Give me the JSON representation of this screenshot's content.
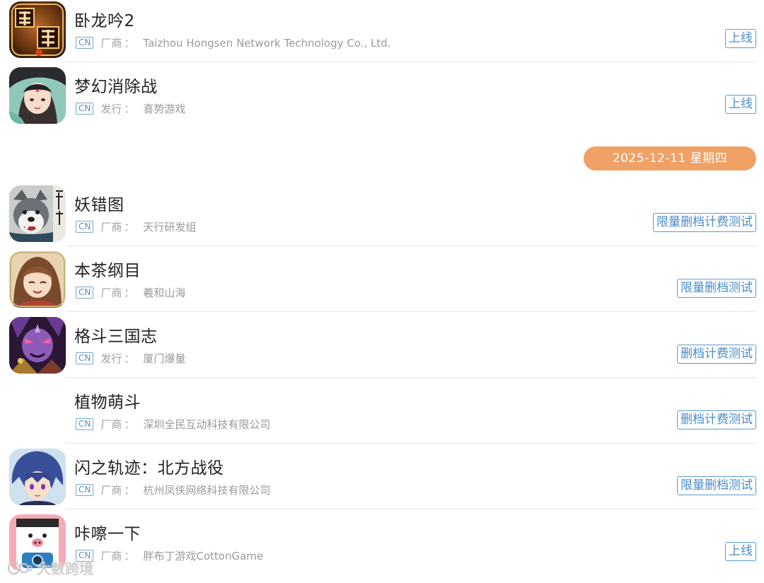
{
  "date_header": "2025-12-11 星期四",
  "watermark": "大数跨境",
  "rows_top": [
    {
      "name": "卧龙吟2",
      "region": "CN",
      "label": "厂商",
      "sep": "：",
      "company": "Taizhou Hongsen Network Technology Co., Ltd.",
      "status": "上线",
      "icon": "wolongyin-2-game-icon"
    },
    {
      "name": "梦幻消除战",
      "region": "CN",
      "label": "发行",
      "sep": "：",
      "company": "喜势游戏",
      "status": "上线",
      "icon": "menghuan-xiaochuzhan-game-icon"
    }
  ],
  "rows_bottom": [
    {
      "name": "妖错图",
      "region": "CN",
      "label": "厂商",
      "sep": "：",
      "company": "天行研发组",
      "status": "限量删档计费测试",
      "icon": "yaocuotu-game-icon"
    },
    {
      "name": "本茶纲目",
      "region": "CN",
      "label": "厂商",
      "sep": "：",
      "company": "羲和山海",
      "status": "限量删档测试",
      "icon": "bencha-gangmu-game-icon"
    },
    {
      "name": "格斗三国志",
      "region": "CN",
      "label": "发行",
      "sep": "：",
      "company": "厦门爆量",
      "status": "删档计费测试",
      "icon": "gedou-sanguozhi-game-icon"
    },
    {
      "name": "植物萌斗",
      "region": "CN",
      "label": "厂商",
      "sep": "：",
      "company": "深圳全民互动科技有限公司",
      "status": "删档计费测试",
      "icon": ""
    },
    {
      "name": "闪之轨迹：北方战役",
      "region": "CN",
      "label": "厂商",
      "sep": "：",
      "company": "杭州凤侠网络科技有限公司",
      "status": "限量删档测试",
      "icon": "senki-no-kiseki-game-icon"
    },
    {
      "name": "咔嚓一下",
      "region": "CN",
      "label": "厂商",
      "sep": "：",
      "company": "胖布丁游戏CottonGame",
      "status": "上线",
      "icon": "kacha-yixia-game-icon"
    }
  ]
}
